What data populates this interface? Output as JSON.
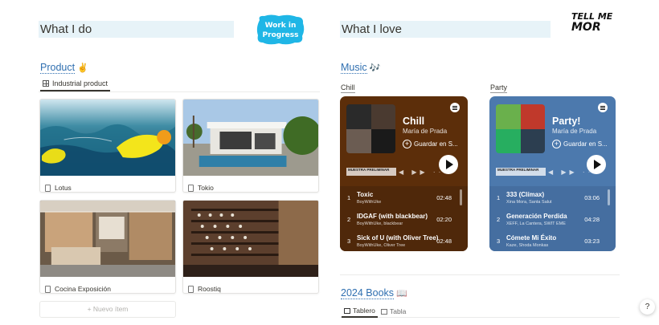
{
  "headers": {
    "left": "What I do",
    "right": "What I love"
  },
  "badge": {
    "line1": "Work in",
    "line2": "Progress",
    "colors": {
      "fill": "#1fb6e6",
      "text": "#ffffff"
    }
  },
  "tellme": {
    "line1": "TELL ME",
    "line2": "MOR"
  },
  "product": {
    "title": "Product",
    "emoji": "✌️",
    "tab": "Industrial product",
    "cards": [
      {
        "label": "Lotus",
        "image": "yellow-kayak-in-water"
      },
      {
        "label": "Tokio",
        "image": "modern-white-house-pool"
      },
      {
        "label": "Cocina Exposición",
        "image": "kitchen-showroom"
      },
      {
        "label": "Roostiq",
        "image": "wine-cellar-rack"
      }
    ],
    "new_item": "+ Nuevo ítem"
  },
  "music": {
    "title": "Music",
    "emoji": "🎶",
    "playlists": [
      {
        "label": "Chill",
        "name": "Chill",
        "owner": "María de Prada",
        "save": "Guardar en S...",
        "preview": "MUESTRA PRELIMINAR",
        "color": "#5c2e0a",
        "tracks": [
          {
            "num": "1",
            "name": "Toxic",
            "artist": "BoyWithUke",
            "dur": "02:48"
          },
          {
            "num": "2",
            "name": "IDGAF (with blackbear)",
            "artist": "BoyWithUke, blackbear",
            "dur": "02:20"
          },
          {
            "num": "3",
            "name": "Sick of U (with Oliver Tree)",
            "artist": "BoyWithUke, Oliver Tree",
            "dur": "02:48"
          }
        ]
      },
      {
        "label": "Party",
        "name": "Party!",
        "owner": "María de Prada",
        "save": "Guardar en S...",
        "preview": "MUESTRA PRELIMINAR",
        "color": "#4c79ad",
        "tracks": [
          {
            "num": "1",
            "name": "333 (Clímax)",
            "artist": "Xina Mora, Santa Salut",
            "dur": "03:06"
          },
          {
            "num": "2",
            "name": "Generación Perdida",
            "artist": "XEFF, La Cantera, SWIT EME",
            "dur": "04:28"
          },
          {
            "num": "3",
            "name": "Cómete Mi Éxito",
            "artist": "Kaze, Shoda Monkas",
            "dur": "03:23"
          }
        ]
      }
    ]
  },
  "books": {
    "title": "2024 Books",
    "emoji": "📖",
    "tabs": [
      "Tablero",
      "Tabla"
    ]
  },
  "help": "?"
}
